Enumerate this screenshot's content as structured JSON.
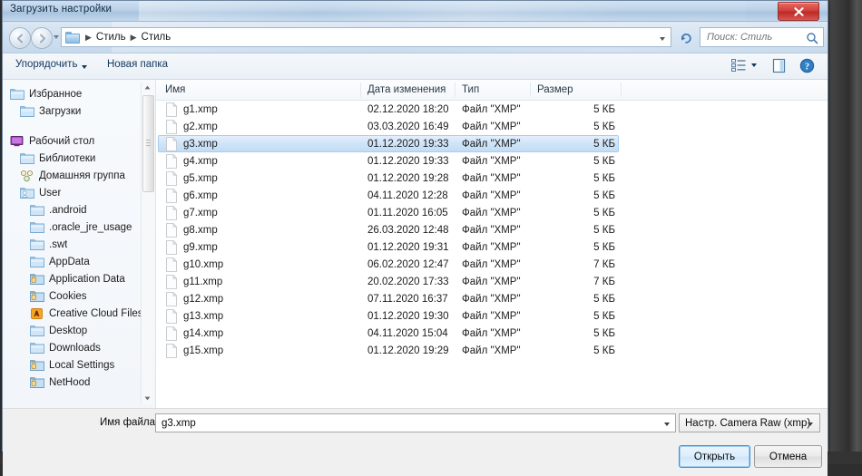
{
  "window": {
    "title": "Загрузить настройки",
    "close_label": "x"
  },
  "nav": {
    "back_icon": "back-arrow-icon",
    "forward_icon": "forward-arrow-icon",
    "breadcrumb": [
      "Стиль",
      "Стиль"
    ],
    "separator": "▶",
    "refresh_icon": "refresh-icon"
  },
  "search": {
    "placeholder": "Поиск: Стиль",
    "value": "",
    "icon": "search-icon"
  },
  "toolbar": {
    "organize_label": "Упорядочить",
    "new_folder_label": "Новая папка",
    "view_icon": "view-list-icon",
    "preview_icon": "preview-pane-icon",
    "help_icon": "help-icon"
  },
  "sidebar": {
    "items": [
      {
        "label": "Избранное",
        "icon": "folder-icon",
        "indent": 0
      },
      {
        "label": "Загрузки",
        "icon": "folder-icon",
        "indent": 1
      },
      {
        "label": "",
        "icon": "spacer",
        "indent": 0
      },
      {
        "label": "Рабочий стол",
        "icon": "desktop-icon",
        "indent": 0
      },
      {
        "label": "Библиотеки",
        "icon": "folder-icon",
        "indent": 1
      },
      {
        "label": "Домашняя группа",
        "icon": "homegroup-icon",
        "indent": 1
      },
      {
        "label": "User",
        "icon": "user-folder-icon",
        "indent": 1
      },
      {
        "label": ".android",
        "icon": "folder-icon",
        "indent": 2
      },
      {
        "label": ".oracle_jre_usage",
        "icon": "folder-icon",
        "indent": 2
      },
      {
        "label": ".swt",
        "icon": "folder-icon",
        "indent": 2
      },
      {
        "label": "AppData",
        "icon": "folder-icon",
        "indent": 2
      },
      {
        "label": "Application Data",
        "icon": "shortcut-folder-icon",
        "indent": 2
      },
      {
        "label": "Cookies",
        "icon": "shortcut-folder-icon",
        "indent": 2
      },
      {
        "label": "Creative Cloud Files",
        "icon": "creative-cloud-icon",
        "indent": 2
      },
      {
        "label": "Desktop",
        "icon": "folder-icon",
        "indent": 2
      },
      {
        "label": "Downloads",
        "icon": "folder-icon",
        "indent": 2
      },
      {
        "label": "Local Settings",
        "icon": "shortcut-folder-icon",
        "indent": 2
      },
      {
        "label": "NetHood",
        "icon": "shortcut-folder-icon",
        "indent": 2
      }
    ]
  },
  "filelist": {
    "columns": [
      "Имя",
      "Дата изменения",
      "Тип",
      "Размер"
    ],
    "sort_indicator": "▲",
    "selected_index": 2,
    "rows": [
      {
        "name": "g1.xmp",
        "date": "02.12.2020 18:20",
        "type": "Файл \"XMP\"",
        "size": "5 КБ"
      },
      {
        "name": "g2.xmp",
        "date": "03.03.2020 16:49",
        "type": "Файл \"XMP\"",
        "size": "5 КБ"
      },
      {
        "name": "g3.xmp",
        "date": "01.12.2020 19:33",
        "type": "Файл \"XMP\"",
        "size": "5 КБ"
      },
      {
        "name": "g4.xmp",
        "date": "01.12.2020 19:33",
        "type": "Файл \"XMP\"",
        "size": "5 КБ"
      },
      {
        "name": "g5.xmp",
        "date": "01.12.2020 19:28",
        "type": "Файл \"XMP\"",
        "size": "5 КБ"
      },
      {
        "name": "g6.xmp",
        "date": "04.11.2020 12:28",
        "type": "Файл \"XMP\"",
        "size": "5 КБ"
      },
      {
        "name": "g7.xmp",
        "date": "01.11.2020 16:05",
        "type": "Файл \"XMP\"",
        "size": "5 КБ"
      },
      {
        "name": "g8.xmp",
        "date": "26.03.2020 12:48",
        "type": "Файл \"XMP\"",
        "size": "5 КБ"
      },
      {
        "name": "g9.xmp",
        "date": "01.12.2020 19:31",
        "type": "Файл \"XMP\"",
        "size": "5 КБ"
      },
      {
        "name": "g10.xmp",
        "date": "06.02.2020 12:47",
        "type": "Файл \"XMP\"",
        "size": "7 КБ"
      },
      {
        "name": "g11.xmp",
        "date": "20.02.2020 17:33",
        "type": "Файл \"XMP\"",
        "size": "7 КБ"
      },
      {
        "name": "g12.xmp",
        "date": "07.11.2020 16:37",
        "type": "Файл \"XMP\"",
        "size": "5 КБ"
      },
      {
        "name": "g13.xmp",
        "date": "01.12.2020 19:30",
        "type": "Файл \"XMP\"",
        "size": "5 КБ"
      },
      {
        "name": "g14.xmp",
        "date": "04.11.2020 15:04",
        "type": "Файл \"XMP\"",
        "size": "5 КБ"
      },
      {
        "name": "g15.xmp",
        "date": "01.12.2020 19:29",
        "type": "Файл \"XMP\"",
        "size": "5 КБ"
      }
    ]
  },
  "footer": {
    "filename_label": "Имя файла:",
    "filename_value": "g3.xmp",
    "filetype_value": "Настр. Camera Raw (xmp)",
    "open_label": "Открыть",
    "cancel_label": "Отмена"
  },
  "colors": {
    "selection": "#c2dcf5",
    "selection_border": "#a7cdee",
    "title_text": "#112a45",
    "close_red": "#d2423c",
    "accent_blue": "#3c8fd4"
  }
}
